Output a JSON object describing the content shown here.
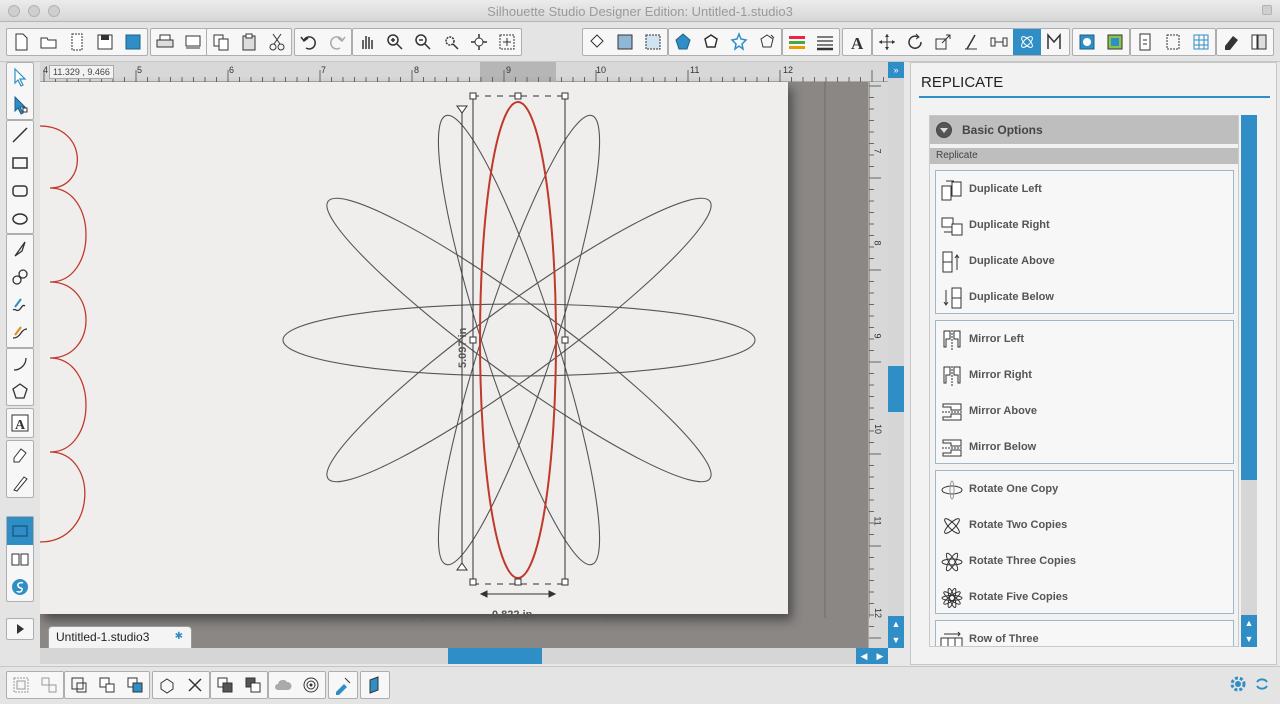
{
  "window": {
    "title": "Silhouette Studio Designer Edition: Untitled-1.studio3"
  },
  "toolbar": {
    "groups": [
      [
        "new-file-icon",
        "open-file-icon",
        "new-library-icon",
        "save-icon",
        "save-to-library-icon"
      ],
      [
        "print-icon",
        "print-cut-icon"
      ],
      [
        "copy-icon",
        "paste-icon",
        "cut-icon"
      ],
      [
        "undo-icon",
        "redo-icon"
      ],
      [
        "pan-hand-icon",
        "zoom-in-icon",
        "zoom-out-icon",
        "zoom-select-icon",
        "zoom-drag-icon",
        "fit-to-page-icon"
      ],
      [
        "fill-bucket-icon",
        "fill-gradient-icon",
        "fill-pattern-icon"
      ],
      [
        "line-color-icon",
        "line-style-icon",
        "offset-icon",
        "trace-icon"
      ],
      [
        "line-color-bars-icon",
        "line-weight-icon"
      ],
      [
        "text-style-icon"
      ],
      [
        "transform-icon",
        "rotate-icon",
        "scale-icon",
        "shear-icon",
        "align-icon",
        "replicate-icon",
        "modify-icon"
      ],
      [
        "page-setup-icon",
        "cut-settings-icon"
      ],
      [
        "send-to-silhouette-icon",
        "layers-icon",
        "grid-icon"
      ],
      [
        "eraser-settings-icon",
        "library-panel-icon"
      ]
    ]
  },
  "canvas": {
    "coordinate_readout": "11.329 , 9.466",
    "ruler_top": [
      "4",
      "5",
      "6",
      "7",
      "8",
      "9",
      "10",
      "11",
      "12"
    ],
    "ruler_right": [
      "7",
      "8",
      "9",
      "10",
      "11",
      "12"
    ],
    "height_dimension": "5.097 in",
    "width_dimension": "0.822 in",
    "document_tab": "Untitled-1.studio3"
  },
  "panel": {
    "title": "REPLICATE",
    "section_title": "Basic Options",
    "section_sub": "Replicate",
    "groups": [
      {
        "items": [
          {
            "icon": "duplicate-left-icon",
            "label": "Duplicate Left"
          },
          {
            "icon": "duplicate-right-icon",
            "label": "Duplicate Right"
          },
          {
            "icon": "duplicate-above-icon",
            "label": "Duplicate Above"
          },
          {
            "icon": "duplicate-below-icon",
            "label": "Duplicate Below"
          }
        ]
      },
      {
        "items": [
          {
            "icon": "mirror-left-icon",
            "label": "Mirror Left"
          },
          {
            "icon": "mirror-right-icon",
            "label": "Mirror Right"
          },
          {
            "icon": "mirror-above-icon",
            "label": "Mirror Above"
          },
          {
            "icon": "mirror-below-icon",
            "label": "Mirror Below"
          }
        ]
      },
      {
        "items": [
          {
            "icon": "rotate-one-copy-icon",
            "label": "Rotate One Copy"
          },
          {
            "icon": "rotate-two-copies-icon",
            "label": "Rotate Two Copies"
          },
          {
            "icon": "rotate-three-copies-icon",
            "label": "Rotate Three Copies"
          },
          {
            "icon": "rotate-five-copies-icon",
            "label": "Rotate Five Copies"
          }
        ]
      },
      {
        "items": [
          {
            "icon": "row-of-three-icon",
            "label": "Row of Three"
          }
        ]
      }
    ]
  },
  "colors": {
    "accent": "#2f8ec6",
    "selected_shape": "#c0392b",
    "shape_stroke": "#555555"
  }
}
